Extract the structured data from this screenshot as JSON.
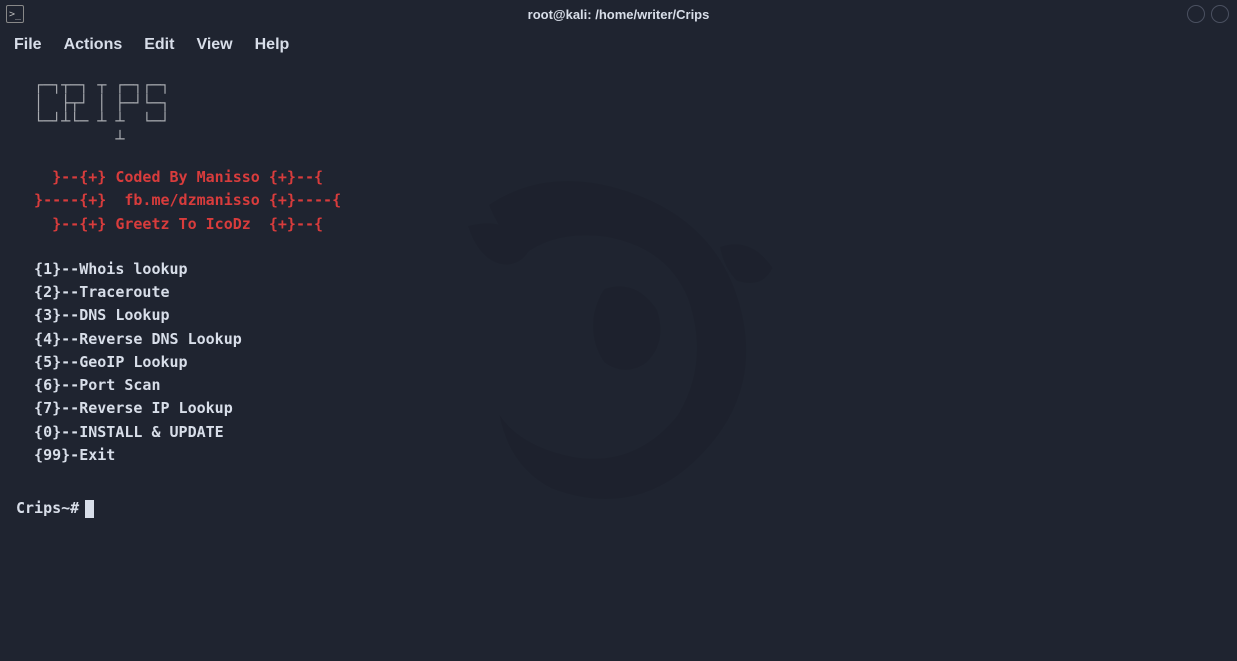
{
  "window": {
    "title": "root@kali: /home/writer/Crips"
  },
  "menubar": {
    "items": [
      "File",
      "Actions",
      "Edit",
      "View",
      "Help"
    ]
  },
  "ascii_banner": "   ___________          _____\n _/ ___\\_  __ \\ |  |\\____ \\/  ___/\n \\  \\___|  | \\/ |  ||  |_> >___ \\\n  \\___  >__|  | |__||   __/____  >\n      \\/   |__|     |__|       \\/",
  "credits": {
    "line1": "    }--{+} Coded By Manisso {+}--{",
    "line2": "  }----{+}  fb.me/dzmanisso {+}----{",
    "line3": "    }--{+} Greetz To IcoDz  {+}--{"
  },
  "options": [
    "  {1}--Whois lookup",
    "  {2}--Traceroute",
    "  {3}--DNS Lookup",
    "  {4}--Reverse DNS Lookup",
    "  {5}--GeoIP Lookup",
    "  {6}--Port Scan",
    "  {7}--Reverse IP Lookup",
    "  {0}--INSTALL & UPDATE",
    "  {99}-Exit"
  ],
  "prompt": "Crips~#"
}
